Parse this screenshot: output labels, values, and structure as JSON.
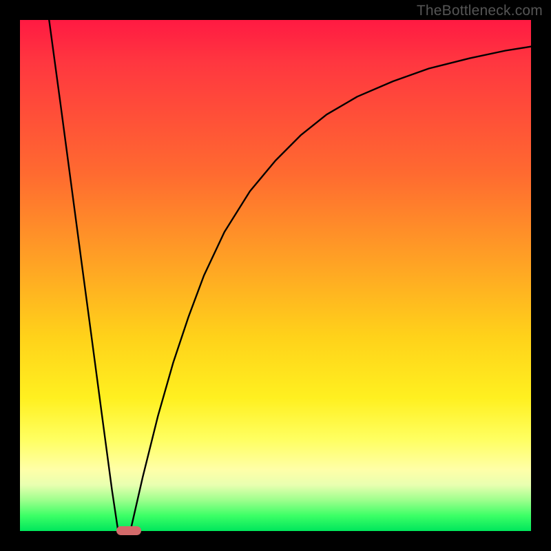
{
  "watermark": "TheBottleneck.com",
  "colors": {
    "frame": "#000000",
    "curve": "#000000",
    "marker": "#d36a6a",
    "gradient_stops": [
      {
        "pct": 0,
        "color": "#ff1a42"
      },
      {
        "pct": 8,
        "color": "#ff3640"
      },
      {
        "pct": 30,
        "color": "#ff6a30"
      },
      {
        "pct": 48,
        "color": "#ffa424"
      },
      {
        "pct": 62,
        "color": "#ffd21a"
      },
      {
        "pct": 74,
        "color": "#fff020"
      },
      {
        "pct": 82,
        "color": "#ffff60"
      },
      {
        "pct": 88,
        "color": "#ffffa8"
      },
      {
        "pct": 91,
        "color": "#e8ffb0"
      },
      {
        "pct": 94,
        "color": "#9cff8c"
      },
      {
        "pct": 97,
        "color": "#3cff66"
      },
      {
        "pct": 100,
        "color": "#00e65c"
      }
    ]
  },
  "marker": {
    "x_frac": 0.192,
    "width_frac": 0.048
  },
  "chart_data": {
    "type": "line",
    "title": "",
    "xlabel": "",
    "ylabel": "",
    "xlim": [
      0,
      1
    ],
    "ylim": [
      0,
      1
    ],
    "note": "Single V-shaped curve (two branches meeting at the bottom). x and y are normalized fractions of the plot area; y=0 is bottom (green), y=1 is top (red). Values estimated from pixels.",
    "series": [
      {
        "name": "left-branch",
        "x": [
          0.057,
          0.08,
          0.1,
          0.12,
          0.14,
          0.16,
          0.18,
          0.192
        ],
        "y": [
          1.0,
          0.83,
          0.68,
          0.53,
          0.38,
          0.23,
          0.08,
          0.0
        ]
      },
      {
        "name": "right-branch",
        "x": [
          0.216,
          0.24,
          0.27,
          0.3,
          0.33,
          0.36,
          0.4,
          0.45,
          0.5,
          0.55,
          0.6,
          0.66,
          0.73,
          0.8,
          0.88,
          0.95,
          1.0
        ],
        "y": [
          0.0,
          0.105,
          0.225,
          0.33,
          0.42,
          0.5,
          0.585,
          0.665,
          0.725,
          0.775,
          0.815,
          0.85,
          0.88,
          0.905,
          0.925,
          0.94,
          0.948
        ]
      }
    ]
  }
}
